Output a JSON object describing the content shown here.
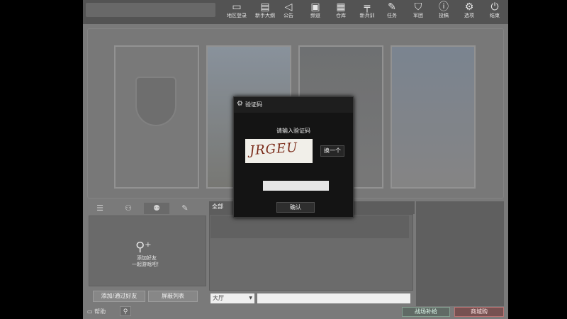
{
  "topbar": {
    "buttons": [
      {
        "label": "地区登录",
        "icon": "monitor-icon"
      },
      {
        "label": "新手大纲",
        "icon": "book-icon"
      },
      {
        "label": "公告",
        "icon": "speaker-icon"
      },
      {
        "label": "频道",
        "icon": "tv-icon"
      },
      {
        "label": "仓库",
        "icon": "bag-icon"
      },
      {
        "label": "新兵训",
        "icon": "gun-icon"
      },
      {
        "label": "任务",
        "icon": "task-icon"
      },
      {
        "label": "军团",
        "icon": "shield-icon"
      },
      {
        "label": "投稿",
        "icon": "alert-icon"
      },
      {
        "label": "选项",
        "icon": "gear-icon"
      },
      {
        "label": "结束",
        "icon": "power-icon"
      }
    ]
  },
  "friends": {
    "hint": "添加好友\n一起游戏吧！",
    "add_button": "添加/通过好友",
    "block_button": "屏蔽列表"
  },
  "chat": {
    "tab_all": "全部",
    "channel": "大厅"
  },
  "footer": {
    "help": "帮助",
    "battle": "战场补给",
    "mall": "商城购"
  },
  "dialog": {
    "title": "验证码",
    "prompt": "请输入验证码",
    "captcha_text": "JRGEU",
    "refresh": "换一个",
    "confirm": "确认"
  }
}
